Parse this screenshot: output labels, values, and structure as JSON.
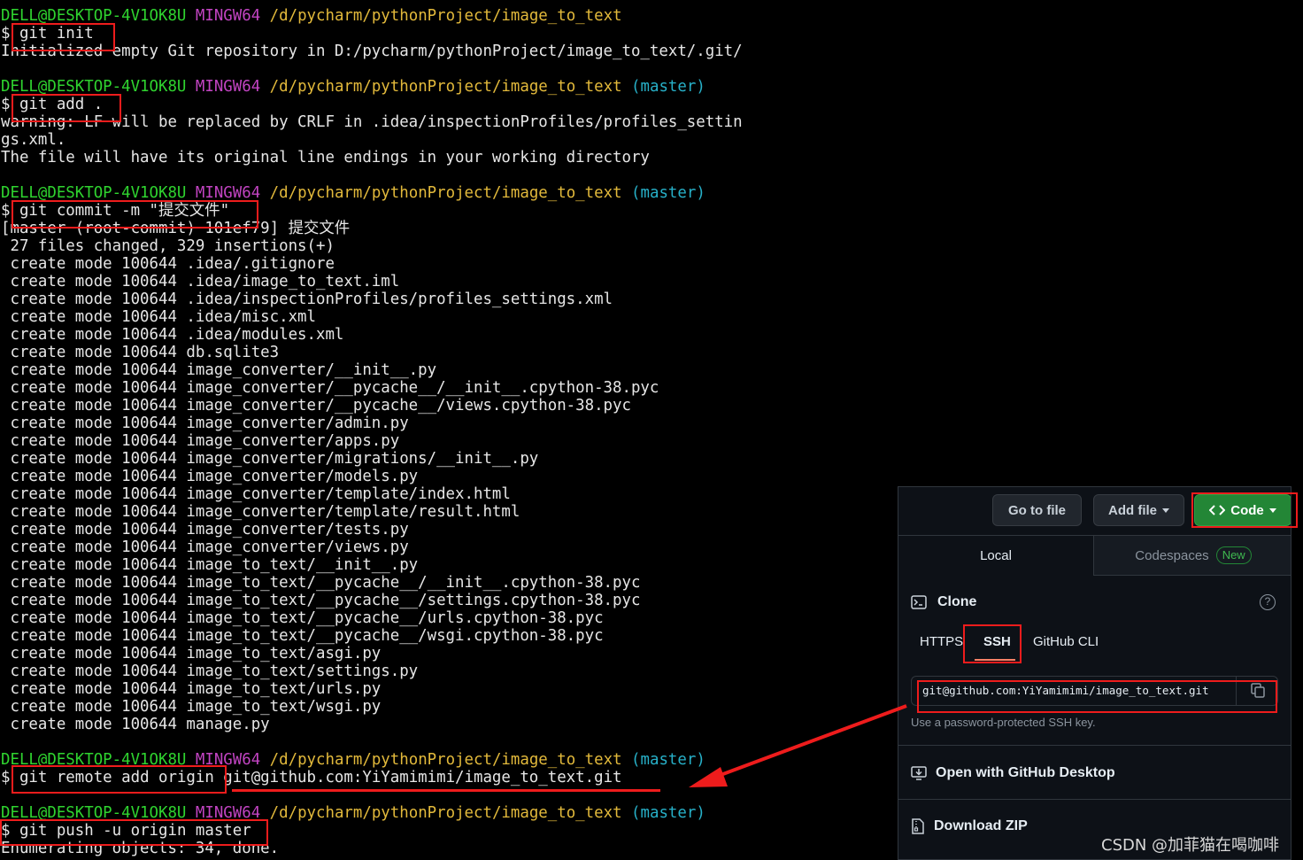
{
  "terminal": {
    "prompt": {
      "user": "DELL@DESKTOP-4V1OK8U",
      "shell": "MINGW64",
      "path": "/d/pycharm/pythonProject/image_to_text",
      "branch": "(master)"
    },
    "blocks": [
      {
        "branch": false,
        "command": "git init",
        "output": [
          "Initialized empty Git repository in D:/pycharm/pythonProject/image_to_text/.git/"
        ]
      },
      {
        "branch": true,
        "command": "git add .",
        "output": [
          "warning: LF will be replaced by CRLF in .idea/inspectionProfiles/profiles_settin",
          "gs.xml.",
          "The file will have its original line endings in your working directory"
        ]
      },
      {
        "branch": true,
        "command": "git commit -m \"提交文件\"",
        "output": [
          "[master (root-commit) 101ef79] 提交文件",
          " 27 files changed, 329 insertions(+)",
          " create mode 100644 .idea/.gitignore",
          " create mode 100644 .idea/image_to_text.iml",
          " create mode 100644 .idea/inspectionProfiles/profiles_settings.xml",
          " create mode 100644 .idea/misc.xml",
          " create mode 100644 .idea/modules.xml",
          " create mode 100644 db.sqlite3",
          " create mode 100644 image_converter/__init__.py",
          " create mode 100644 image_converter/__pycache__/__init__.cpython-38.pyc",
          " create mode 100644 image_converter/__pycache__/views.cpython-38.pyc",
          " create mode 100644 image_converter/admin.py",
          " create mode 100644 image_converter/apps.py",
          " create mode 100644 image_converter/migrations/__init__.py",
          " create mode 100644 image_converter/models.py",
          " create mode 100644 image_converter/template/index.html",
          " create mode 100644 image_converter/template/result.html",
          " create mode 100644 image_converter/tests.py",
          " create mode 100644 image_converter/views.py",
          " create mode 100644 image_to_text/__init__.py",
          " create mode 100644 image_to_text/__pycache__/__init__.cpython-38.pyc",
          " create mode 100644 image_to_text/__pycache__/settings.cpython-38.pyc",
          " create mode 100644 image_to_text/__pycache__/urls.cpython-38.pyc",
          " create mode 100644 image_to_text/__pycache__/wsgi.cpython-38.pyc",
          " create mode 100644 image_to_text/asgi.py",
          " create mode 100644 image_to_text/settings.py",
          " create mode 100644 image_to_text/urls.py",
          " create mode 100644 image_to_text/wsgi.py",
          " create mode 100644 manage.py"
        ]
      },
      {
        "branch": true,
        "command": "git remote add origin git@github.com:YiYamimimi/image_to_text.git",
        "output": []
      },
      {
        "branch": true,
        "command": "git push -u origin master",
        "output": [
          "Enumerating objects: 34, done."
        ]
      }
    ]
  },
  "github_panel": {
    "go_to_file": "Go to file",
    "add_file": "Add file",
    "code": "Code",
    "tab_local": "Local",
    "tab_codespaces": "Codespaces",
    "new_badge": "New",
    "clone_title": "Clone",
    "protocols": [
      "HTTPS",
      "SSH",
      "GitHub CLI"
    ],
    "active_protocol": "SSH",
    "clone_url": "git@github.com:YiYamimimi/image_to_text.git",
    "ssh_hint": "Use a password-protected SSH key.",
    "open_desktop": "Open with GitHub Desktop",
    "download_zip": "Download ZIP"
  },
  "watermark": "CSDN @加菲猫在喝咖啡",
  "colors": {
    "annotation_red": "#ee1c1c",
    "prompt_user": "#2fd42f",
    "prompt_shell": "#c244c2",
    "prompt_path": "#e2b93b",
    "prompt_branch": "#27b0c8",
    "code_button": "#238636"
  }
}
